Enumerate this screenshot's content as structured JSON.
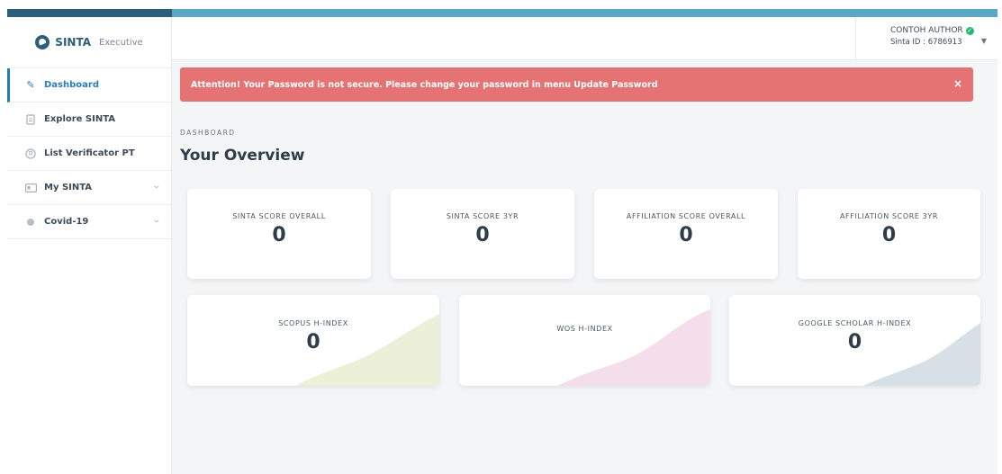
{
  "brand": {
    "name": "SINTA",
    "subtitle": "Executive"
  },
  "sidebar": {
    "items": [
      {
        "label": "Dashboard",
        "icon": "pencil-icon",
        "active": true
      },
      {
        "label": "Explore SINTA",
        "icon": "document-icon"
      },
      {
        "label": "List Verificator PT",
        "icon": "user-circle-icon"
      },
      {
        "label": "My SINTA",
        "icon": "id-card-icon",
        "has_submenu": true
      },
      {
        "label": "Covid-19",
        "icon": "virus-icon",
        "has_submenu": true
      }
    ]
  },
  "header": {
    "user_name": "CONTOH AUTHOR",
    "sinta_id": "Sinta ID : 6786913"
  },
  "alert": {
    "message": "Attention! Your Password is not secure. Please change your password in menu Update Password",
    "close": "×",
    "color": "#e57373"
  },
  "page": {
    "breadcrumb": "DASHBOARD",
    "title": "Your Overview"
  },
  "cards_row1": [
    {
      "label": "SINTA SCORE OVERALL",
      "value": "0"
    },
    {
      "label": "SINTA SCORE 3YR",
      "value": "0"
    },
    {
      "label": "AFFILIATION SCORE OVERALL",
      "value": "0"
    },
    {
      "label": "AFFILIATION SCORE 3YR",
      "value": "0"
    }
  ],
  "cards_row2": [
    {
      "label": "SCOPUS H-INDEX",
      "value": "0",
      "accent": "#e8ecd0"
    },
    {
      "label": "WOS H-INDEX",
      "value": "",
      "accent": "#f1d3e6"
    },
    {
      "label": "GOOGLE SCHOLAR H-INDEX",
      "value": "0",
      "accent": "#cfdbe2"
    }
  ]
}
